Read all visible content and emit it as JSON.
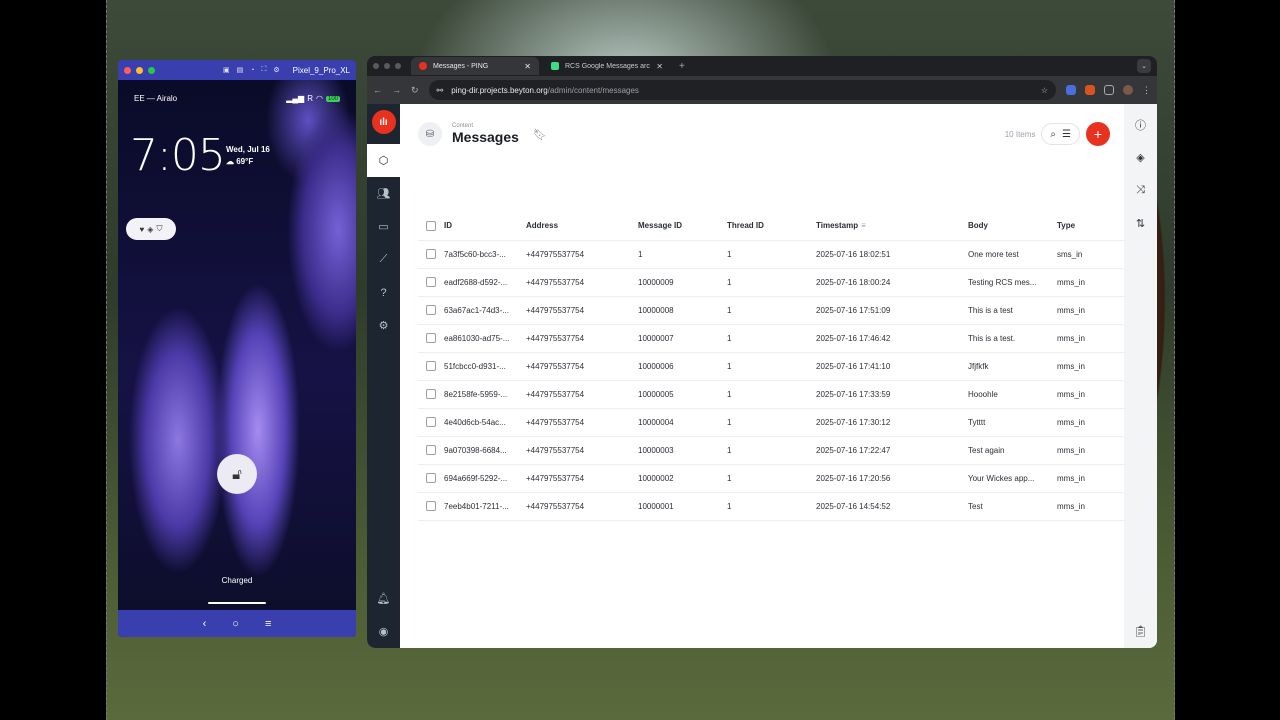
{
  "emulator": {
    "device_name": "Pixel_9_Pro_XL",
    "carrier": "EE — Airalo",
    "signal": "R",
    "battery": "100",
    "time": "7:05",
    "date": "Wed, Jul 16",
    "weather": "69°F",
    "charged": "Charged",
    "nav": {
      "back": "‹",
      "home": "○",
      "menu": "≡"
    }
  },
  "browser": {
    "tabs": [
      {
        "label": "Messages - PING",
        "active": true
      },
      {
        "label": "RCS Google Messages archi",
        "active": false
      }
    ],
    "url_host": "ping-dir.projects.beyton.org",
    "url_path": "/admin/content/messages"
  },
  "app": {
    "breadcrumb": "Content",
    "title": "Messages",
    "item_count": "10 Items",
    "add_label": "+",
    "columns": [
      "ID",
      "Address",
      "Message ID",
      "Thread ID",
      "Timestamp",
      "Body",
      "Type"
    ],
    "rows": [
      [
        "7a3f5c60-bcc3-...",
        "+447975537754",
        "1",
        "1",
        "2025-07-16 18:02:51",
        "One more test",
        "sms_in"
      ],
      [
        "eadf2688-d592-...",
        "+447975537754",
        "10000009",
        "1",
        "2025-07-16 18:00:24",
        "Testing RCS mes...",
        "mms_in"
      ],
      [
        "63a67ac1-74d3-...",
        "+447975537754",
        "10000008",
        "1",
        "2025-07-16 17:51:09",
        "This is a test",
        "mms_in"
      ],
      [
        "ea861030-ad75-...",
        "+447975537754",
        "10000007",
        "1",
        "2025-07-16 17:46:42",
        "This is a test.",
        "mms_in"
      ],
      [
        "51fcbcc0-d931-...",
        "+447975537754",
        "10000006",
        "1",
        "2025-07-16 17:41:10",
        "Jfjfkfk",
        "mms_in"
      ],
      [
        "8e2158fe-5959-...",
        "+447975537754",
        "10000005",
        "1",
        "2025-07-16 17:33:59",
        "Hooohle",
        "mms_in"
      ],
      [
        "4e40d6cb-54ac...",
        "+447975537754",
        "10000004",
        "1",
        "2025-07-16 17:30:12",
        "Tytttt",
        "mms_in"
      ],
      [
        "9a070398-6684...",
        "+447975537754",
        "10000003",
        "1",
        "2025-07-16 17:22:47",
        "Test again",
        "mms_in"
      ],
      [
        "694a669f-5292-...",
        "+447975537754",
        "10000002",
        "1",
        "2025-07-16 17:20:56",
        "Your Wickes app...",
        "mms_in"
      ],
      [
        "7eeb4b01-7211-...",
        "+447975537754",
        "10000001",
        "1",
        "2025-07-16 14:54:52",
        "Test",
        "mms_in"
      ]
    ]
  },
  "colors": {
    "accent": "#e8321f",
    "nav_bg": "#1c2530",
    "emulator_frame": "#3a3fb0"
  }
}
